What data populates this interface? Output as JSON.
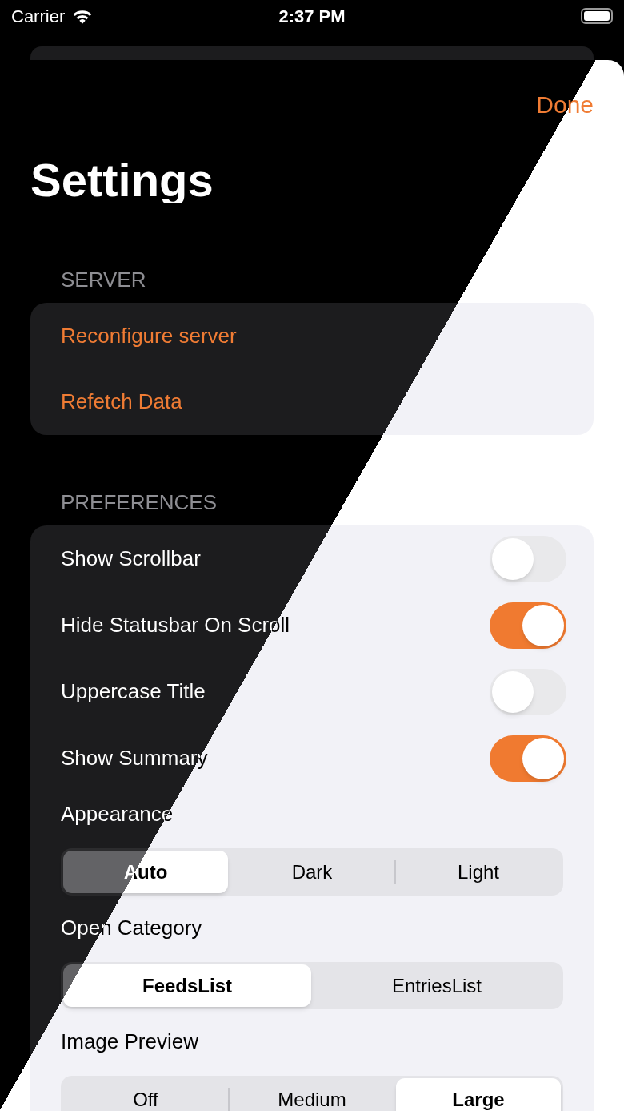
{
  "status_bar": {
    "carrier": "Carrier",
    "time": "2:37 PM"
  },
  "nav": {
    "done": "Done"
  },
  "title": "Settings",
  "sections": [
    {
      "header": "SERVER",
      "items": [
        {
          "kind": "action",
          "label": "Reconfigure server"
        },
        {
          "kind": "action",
          "label": "Refetch Data"
        }
      ]
    },
    {
      "header": "PREFERENCES",
      "items": [
        {
          "kind": "toggle",
          "label": "Show Scrollbar",
          "on": false
        },
        {
          "kind": "toggle",
          "label": "Hide Statusbar On Scroll",
          "on": true
        },
        {
          "kind": "toggle",
          "label": "Uppercase Title",
          "on": false
        },
        {
          "kind": "toggle",
          "label": "Show Summary",
          "on": true
        },
        {
          "kind": "segmented",
          "label": "Appearance",
          "options": [
            {
              "label": "Auto",
              "selected": true
            },
            {
              "label": "Dark",
              "selected": false
            },
            {
              "label": "Light",
              "selected": false
            }
          ]
        },
        {
          "kind": "segmented",
          "label": "Open Category",
          "options": [
            {
              "label": "FeedsList",
              "selected": true
            },
            {
              "label": "EntriesList",
              "selected": false
            }
          ]
        },
        {
          "kind": "segmented",
          "label": "Image Preview",
          "options": [
            {
              "label": "Off",
              "selected": false
            },
            {
              "label": "Medium",
              "selected": false
            },
            {
              "label": "Large",
              "selected": true
            }
          ]
        }
      ]
    }
  ]
}
